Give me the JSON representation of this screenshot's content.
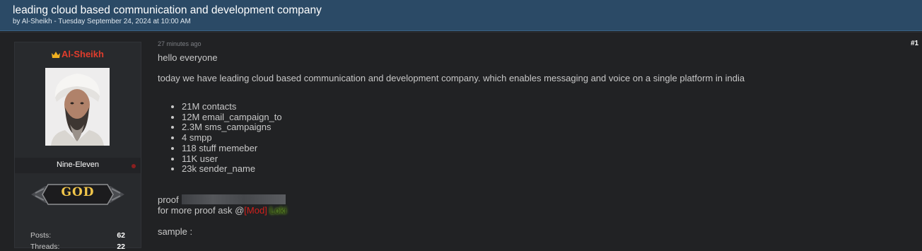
{
  "thread": {
    "title": "leading cloud based communication and development company",
    "byline": "by Al-Sheikh - Tuesday September 24, 2024 at 10:00 AM"
  },
  "author": {
    "username": "Al-Sheikh",
    "user_title": "Nine-Eleven",
    "rank": "GOD",
    "icons": [
      "crown-icon",
      "avatar",
      "status-dot",
      "rank-badge"
    ],
    "colors": {
      "username": "#e03c2c",
      "rank": "#f0c54a",
      "header": "#2b4a66"
    },
    "stats": [
      {
        "label": "Posts:",
        "value": "62"
      },
      {
        "label": "Threads:",
        "value": "22"
      }
    ]
  },
  "post": {
    "time": "27 minutes ago",
    "number": "#1",
    "greeting": "hello everyone",
    "intro": "today we have leading cloud based communication and development company. which enables messaging and voice on a single platform in india",
    "items": [
      "21M contacts",
      "12M email_campaign_to",
      "2.3M sms_campaigns",
      "4 smpp",
      "118 stuff memeber",
      "11K user",
      "23k sender_name"
    ],
    "proof_label": "proof",
    "more_proof": "for more proof ask @",
    "mod_tag": "[Mod]",
    "mod_name": "Loki",
    "sample_label": "sample :"
  }
}
